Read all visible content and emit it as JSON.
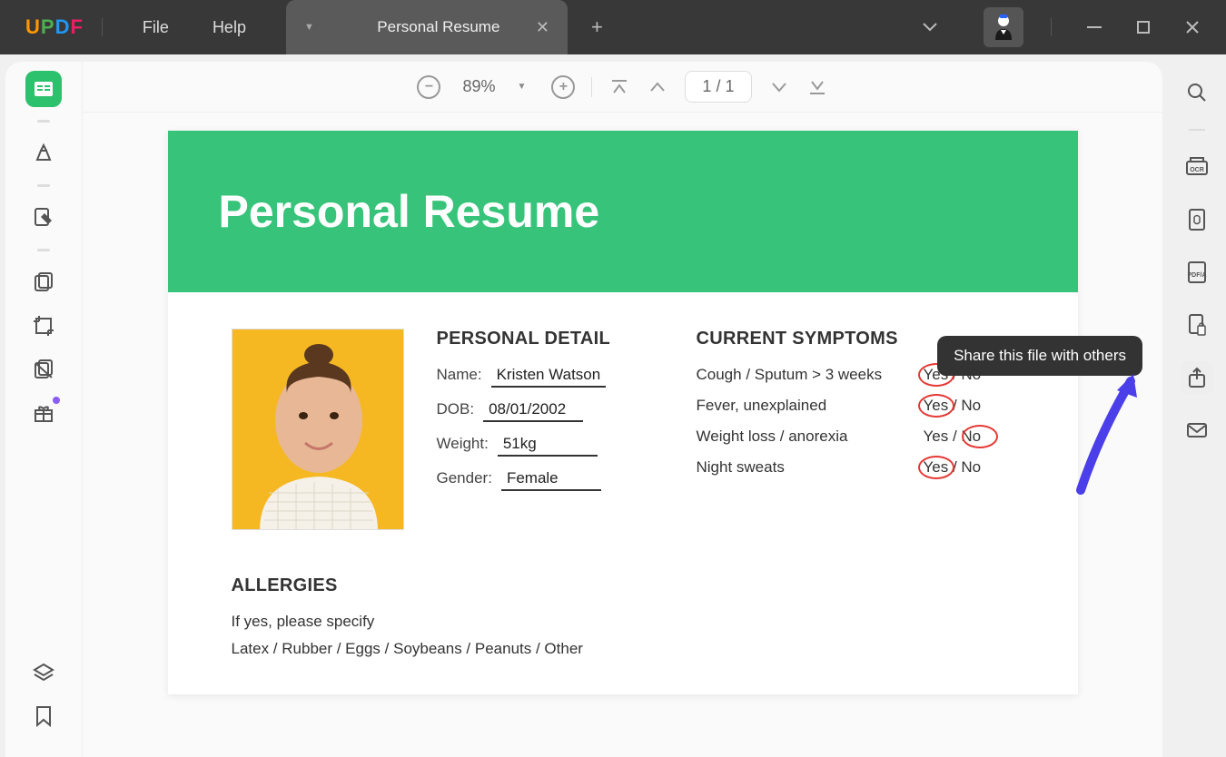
{
  "menu": {
    "file": "File",
    "help": "Help"
  },
  "tab": {
    "title": "Personal Resume"
  },
  "toolbar": {
    "zoom": "89%",
    "page_current": "1",
    "page_sep": "/",
    "page_total": "1"
  },
  "document": {
    "title": "Personal Resume",
    "personal_detail_heading": "PERSONAL DETAIL",
    "details": {
      "name_label": "Name:",
      "name_value": "Kristen Watson",
      "dob_label": "DOB:",
      "dob_value": "08/01/2002",
      "weight_label": "Weight:",
      "weight_value": "51kg",
      "gender_label": "Gender:",
      "gender_value": "Female"
    },
    "symptoms_heading": "CURRENT SYMPTOMS",
    "symptoms": [
      {
        "label": "Cough / Sputum > 3 weeks",
        "yesno": "Yes / No",
        "selected": "Yes"
      },
      {
        "label": "Fever, unexplained",
        "yesno": "Yes / No",
        "selected": "Yes"
      },
      {
        "label": "Weight loss / anorexia",
        "yesno": "Yes / No",
        "selected": "No"
      },
      {
        "label": "Night sweats",
        "yesno": "Yes / No",
        "selected": "Yes"
      }
    ],
    "allergies_heading": "ALLERGIES",
    "allergies_specify": "If yes, please specify",
    "allergies_list": "Latex / Rubber / Eggs / Soybeans / Peanuts / Other"
  },
  "tooltip": {
    "share": "Share this file with others"
  }
}
